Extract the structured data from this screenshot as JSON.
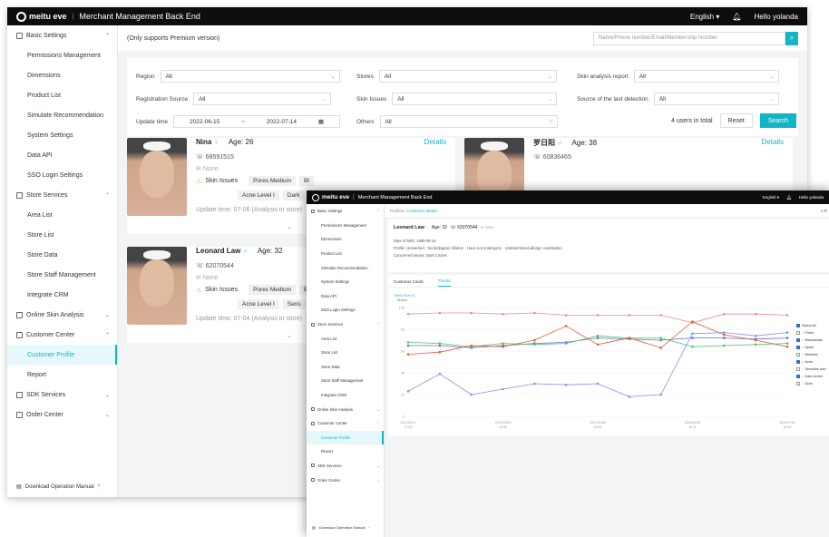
{
  "brand": {
    "logo": "meitu eve",
    "title": "Merchant Management Back End"
  },
  "topbar": {
    "language": "English",
    "user": "Hello yolanda"
  },
  "sidebar": {
    "groups": [
      {
        "label": "Basic Settings",
        "items": [
          "Permissions Management",
          "Dimensions",
          "Product List",
          "Simulate Recommendation",
          "System Settings",
          "Data API",
          "SSO Login Settings"
        ]
      },
      {
        "label": "Store Services",
        "items": [
          "Area List",
          "Store List",
          "Store Data",
          "Store Staff Management",
          "Integrate CRM"
        ]
      },
      {
        "label": "Online Skin Analysis",
        "items": []
      },
      {
        "label": "Customer Center",
        "items": [
          "Customer Profile",
          "Report"
        ]
      },
      {
        "label": "SDK Services",
        "items": []
      },
      {
        "label": "Order Center",
        "items": []
      }
    ],
    "footer": "Download Operation Manual"
  },
  "subbar": {
    "note": "(Only supports Premium version)",
    "search_placeholder": "Name/Phone number/Email/Membership Number"
  },
  "filters": {
    "region": {
      "label": "Region",
      "value": "All"
    },
    "stores": {
      "label": "Stores",
      "value": "All"
    },
    "skin_report": {
      "label": "Skin analysis report",
      "value": "All"
    },
    "reg_source": {
      "label": "Registration Source",
      "value": "All"
    },
    "skin_issues": {
      "label": "Skin Issues",
      "value": "All"
    },
    "last_detection": {
      "label": "Source of the last detection",
      "value": "All"
    },
    "update_time": {
      "label": "Update time",
      "start": "2022-06-15",
      "sep": "~",
      "end": "2022-07-14"
    },
    "others": {
      "label": "Others",
      "value": "All"
    },
    "total": "4 users in total",
    "reset": "Reset",
    "search": "Search"
  },
  "cards": [
    {
      "name": "Nina",
      "gender": "♀",
      "age": "Age: 26",
      "phone": "68591515",
      "email": "None",
      "skin_label": "Skin Issues",
      "tags1": [
        "Pores Medium",
        "Bl"
      ],
      "tags2": [
        "Acne Level I",
        "Dark"
      ],
      "update": "Update time: 07-06 (Analysis in store)",
      "details": "Details"
    },
    {
      "name": "罗日阳",
      "gender": "♂",
      "age": "Age: 38",
      "phone": "60836465",
      "details": "Details"
    },
    {
      "name": "Leonard Law",
      "gender": "♂",
      "age": "Age: 32",
      "phone": "62070544",
      "email": "None",
      "skin_label": "Skin Issues",
      "tags1": [
        "Pores Medium",
        "Bl"
      ],
      "tags2": [
        "Acne Level I",
        "Sens"
      ],
      "update": "Update time: 07-04 (Analysis in store)",
      "details": "Details"
    }
  ],
  "detail": {
    "crumb": "Profiles",
    "crumb_cur": "Customer details",
    "back": "< P",
    "name": "Leonard Law",
    "age": "Age: 32",
    "phone": "62070544",
    "email": "None",
    "dob": "Date of birth: 1990-05-16",
    "profile": "Profile: Unmarried · No biological children · Have not undergone · Undetermined allergic constitution",
    "concerned": "Concerned issues: Dark Circles",
    "tabs": [
      "Customer Cards",
      "Trends"
    ],
    "chart_sub": "Meitu Eve AI",
    "chart_ylabel": "Marks"
  },
  "chart_data": {
    "type": "line",
    "ylabel": "Marks",
    "ylim": [
      0,
      100
    ],
    "yticks": [
      0,
      20,
      40,
      60,
      80,
      100
    ],
    "x": [
      "2021/09/27 17:02",
      "",
      "",
      "2021/10/04 10:08",
      "",
      "",
      "2021/11/08 22:02",
      "",
      "",
      "2022/01/03 16:21",
      "",
      "",
      "2022/07/04 16:40"
    ],
    "series": [
      {
        "name": "Pores",
        "color": "#f08c8c",
        "values": [
          94,
          95,
          95,
          94,
          95,
          93,
          93,
          93,
          93,
          86,
          94,
          94,
          93
        ]
      },
      {
        "name": "Blackheads",
        "color": "#6c6cd8",
        "values": [
          65,
          65,
          63,
          65,
          67,
          68,
          72,
          71,
          70,
          72,
          72,
          71,
          72
        ]
      },
      {
        "name": "Spots",
        "color": "#4fc26b",
        "values": [
          68,
          67,
          64,
          67,
          66,
          67,
          74,
          72,
          72,
          64,
          65,
          66,
          67
        ]
      },
      {
        "name": "Acne",
        "color": "#e85a3a",
        "values": [
          57,
          59,
          65,
          64,
          70,
          83,
          66,
          72,
          63,
          87,
          75,
          70,
          64
        ]
      },
      {
        "name": "Dark circles",
        "color": "#7d95e8",
        "values": [
          23,
          39,
          20,
          25,
          30,
          29,
          30,
          18,
          20,
          76,
          77,
          74,
          77
        ]
      }
    ],
    "legend": [
      {
        "label": "Select All",
        "checked": true
      },
      {
        "label": "Pores",
        "checked": false
      },
      {
        "label": "Blackheads",
        "checked": true
      },
      {
        "label": "Spots",
        "checked": true
      },
      {
        "label": "Wrinkles",
        "checked": false
      },
      {
        "label": "Acne",
        "checked": true
      },
      {
        "label": "Sensitive skin",
        "checked": false
      },
      {
        "label": "Dark circles",
        "checked": true
      },
      {
        "label": "Glow",
        "checked": false
      }
    ]
  }
}
